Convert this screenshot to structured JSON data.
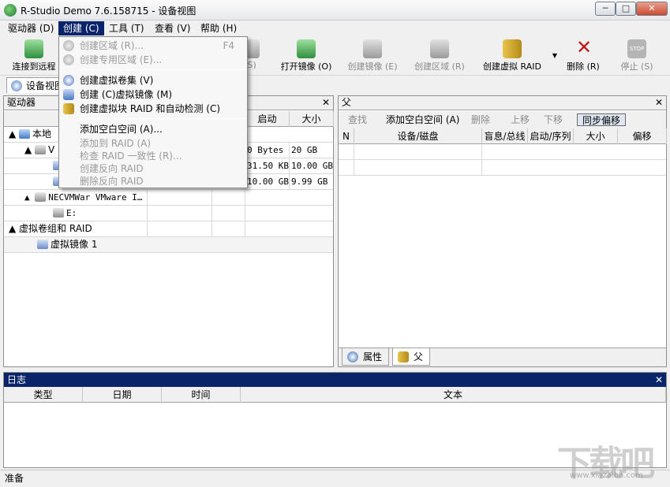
{
  "window": {
    "title": "R-Studio Demo 7.6.158715 - 设备视图",
    "min": "─",
    "max": "□",
    "close": "✕"
  },
  "menubar": [
    "驱动器 (D)",
    "创建 (C)",
    "工具 (T)",
    "查看 (V)",
    "帮助 (H)"
  ],
  "toolbar": {
    "connect": "连接到远程",
    "scan_suffix": "(S)",
    "open_image": "打开镜像 (O)",
    "create_image": "创建镜像 (E)",
    "create_region": "创建区域 (R)",
    "create_raid": "创建虚拟 RAID",
    "delete": "删除 (R)",
    "stop": "停止 (S)",
    "stop_icon_text": "STOP"
  },
  "tab": {
    "device_view": "设备视图"
  },
  "drives": {
    "title": "驱动器",
    "close": "✕",
    "columns": [
      "设",
      "启动",
      "大小"
    ],
    "rows": [
      {
        "name": "本地",
        "start": "",
        "size": ""
      },
      {
        "name": "V",
        "start": "0 Bytes",
        "size": "20 GB"
      },
      {
        "name": "",
        "start": "31.50 KB",
        "size": "10.00 GB"
      },
      {
        "name": "",
        "start": "10.00 GB",
        "size": "9.99 GB"
      },
      {
        "name": "NECVMWar VMware I…",
        "start": "",
        "size": ""
      },
      {
        "name": "E:",
        "start": "",
        "size": ""
      },
      {
        "name": "虚拟卷组和 RAID",
        "start": "",
        "size": ""
      },
      {
        "name": "虚拟镜像 1",
        "start": "",
        "size": ""
      }
    ]
  },
  "parent": {
    "title": "父",
    "close": "✕",
    "tools": {
      "find": "查找",
      "add_blank": "添加空白空间 (A)",
      "delete": "删除",
      "up": "上移",
      "down": "下移",
      "sync_offset": "同步偏移"
    },
    "columns": [
      "N",
      "设备/磁盘",
      "盲息/总线",
      "启动/序列",
      "大小",
      "偏移"
    ],
    "tabs": {
      "properties": "属性",
      "parent": "父"
    }
  },
  "log": {
    "title": "日志",
    "close": "✕",
    "columns": [
      "类型",
      "日期",
      "时间",
      "文本"
    ]
  },
  "status": "准备",
  "dropdown": {
    "items": [
      {
        "label": "创建区域 (R)...",
        "shortcut": "F4",
        "disabled": true
      },
      {
        "label": "创建专用区域 (E)...",
        "shortcut": "",
        "disabled": true
      },
      {
        "label": "创建虚拟卷集 (V)",
        "shortcut": "",
        "disabled": false
      },
      {
        "label": "创建 (C)虚拟镜像 (M)",
        "shortcut": "",
        "disabled": false
      },
      {
        "label": "创建虚拟块 RAID 和自动检测 (C)",
        "shortcut": "",
        "disabled": false
      },
      {
        "label": "添加空白空间 (A)...",
        "shortcut": "",
        "disabled": false
      },
      {
        "label": "添加到 RAID (A)",
        "shortcut": "",
        "disabled": true
      },
      {
        "label": "检查 RAID 一致性 (R)...",
        "shortcut": "",
        "disabled": true
      },
      {
        "label": "创建反向 RAID",
        "shortcut": "",
        "disabled": true
      },
      {
        "label": "删除反向 RAID",
        "shortcut": "",
        "disabled": true
      }
    ]
  },
  "watermark": {
    "text": "下载吧",
    "url": "www.xiazaiba.com"
  }
}
